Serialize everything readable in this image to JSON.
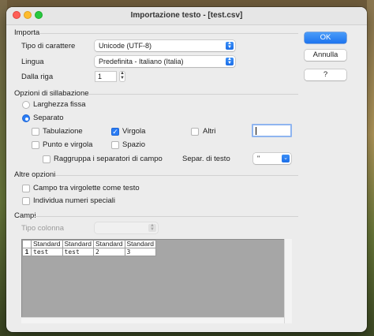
{
  "window": {
    "title": "Importazione testo - [test.csv]"
  },
  "import": {
    "heading": "Importa",
    "charset_label": "Tipo di carattere",
    "charset_value": "Unicode (UTF-8)",
    "language_label": "Lingua",
    "language_value": "Predefinita - Italiano (Italia)",
    "from_row_label": "Dalla riga",
    "from_row_value": "1"
  },
  "separators": {
    "heading": "Opzioni di sillabazione",
    "fixed_width_label": "Larghezza fissa",
    "separated_label": "Separato",
    "mode": "Separato",
    "tab_label": "Tabulazione",
    "tab_checked": false,
    "comma_label": "Virgola",
    "comma_checked": true,
    "other_label": "Altri",
    "other_checked": false,
    "other_value": "",
    "semicolon_label": "Punto e virgola",
    "semicolon_checked": false,
    "space_label": "Spazio",
    "space_checked": false,
    "merge_label": "Raggruppa i separatori di campo",
    "merge_checked": false,
    "text_delim_label": "Separ. di testo",
    "text_delim_value": "\""
  },
  "other_options": {
    "heading": "Altre opzioni",
    "quoted_label": "Campo tra virgolette come testo",
    "quoted_checked": false,
    "special_numbers_label": "Individua numeri speciali",
    "special_numbers_checked": false
  },
  "fields": {
    "heading": "Campi",
    "column_type_label": "Tipo colonna",
    "column_type_value": "",
    "header_row": [
      "Standard",
      "Standard",
      "Standard",
      "Standard"
    ],
    "rows": [
      {
        "num": "1",
        "cells": [
          "test",
          "test",
          "2",
          "3"
        ]
      }
    ]
  },
  "buttons": {
    "ok": "OK",
    "cancel": "Annulla",
    "help": "?"
  },
  "colors": {
    "accent": "#2a7cf5",
    "preview_bg": "#a6a6a6"
  }
}
